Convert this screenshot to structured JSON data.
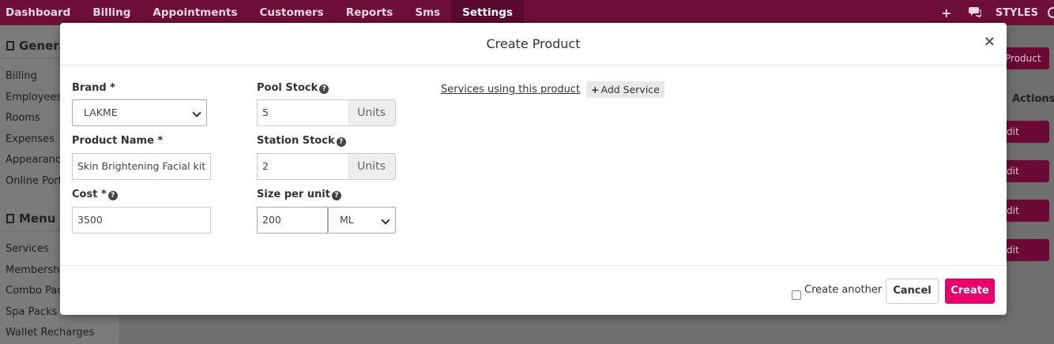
{
  "nav": {
    "items": [
      "Dashboard",
      "Billing",
      "Appointments",
      "Customers",
      "Reports",
      "Sms",
      "Settings"
    ],
    "active": "Settings",
    "add_icon": "+",
    "chat_icon": "chat-icon",
    "styles_label": "STYLES"
  },
  "sidebar": {
    "general_heading": "General",
    "general_links": [
      "Billing",
      "Employees",
      "Rooms",
      "Expenses",
      "Appearance",
      "Online Port"
    ],
    "menu_heading": "Menu",
    "menu_links": [
      "Services",
      "Membership",
      "Combo Pack",
      "Spa Packs",
      "Wallet Recharges"
    ]
  },
  "background": {
    "add_product_label": "Product",
    "actions_label": "Actions",
    "edit_label": "dit"
  },
  "modal": {
    "title": "Create Product",
    "close": "×",
    "brand": {
      "label": "Brand *",
      "value": "LAKME"
    },
    "product_name": {
      "label": "Product Name *",
      "value": "Skin Brightening Facial kit"
    },
    "cost": {
      "label": "Cost *",
      "value": "3500"
    },
    "pool_stock": {
      "label": "Pool Stock",
      "value": "5",
      "unit": "Units"
    },
    "station_stock": {
      "label": "Station Stock",
      "value": "2",
      "unit": "Units"
    },
    "size_per_unit": {
      "label": "Size per unit",
      "value": "200",
      "unit": "ML"
    },
    "services_link": "Services using this product",
    "add_service": "Add Service",
    "create_another": "Create another",
    "cancel": "Cancel",
    "create": "Create"
  }
}
